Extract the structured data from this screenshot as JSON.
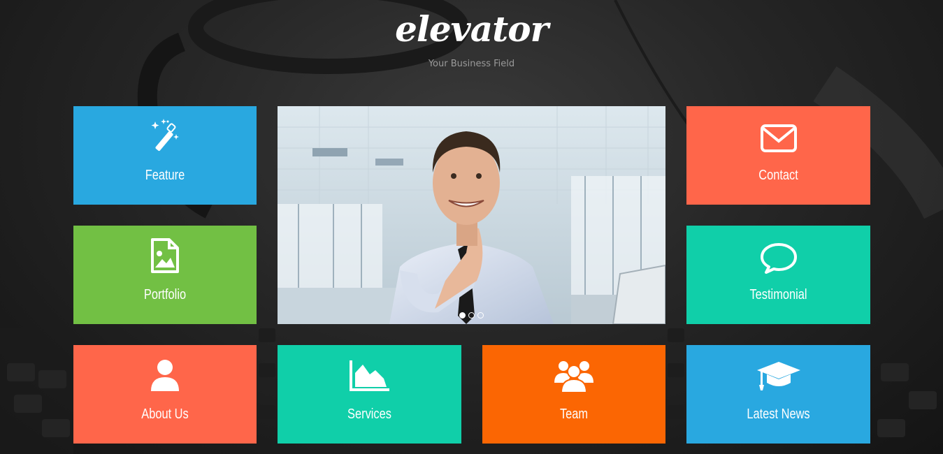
{
  "brand": {
    "logo": "elevator",
    "tagline": "Your Business Field"
  },
  "tiles": [
    {
      "label": "Feature",
      "icon": "magic-wand-icon",
      "color": "#29a8e0"
    },
    {
      "label": "Portfolio",
      "icon": "image-file-icon",
      "color": "#72c044"
    },
    {
      "label": "About Us",
      "icon": "user-icon",
      "color": "#ff664a"
    },
    {
      "label": "Services",
      "icon": "area-chart-icon",
      "color": "#10cfa9"
    },
    {
      "label": "Team",
      "icon": "group-icon",
      "color": "#fb6603"
    },
    {
      "label": "Contact",
      "icon": "envelope-icon",
      "color": "#ff664a"
    },
    {
      "label": "Testimonial",
      "icon": "speech-bubble-icon",
      "color": "#10cfa9"
    },
    {
      "label": "Latest News",
      "icon": "graduation-cap-icon",
      "color": "#29a8e0"
    }
  ],
  "slider": {
    "slide_count": 3,
    "active_slide": 1
  }
}
